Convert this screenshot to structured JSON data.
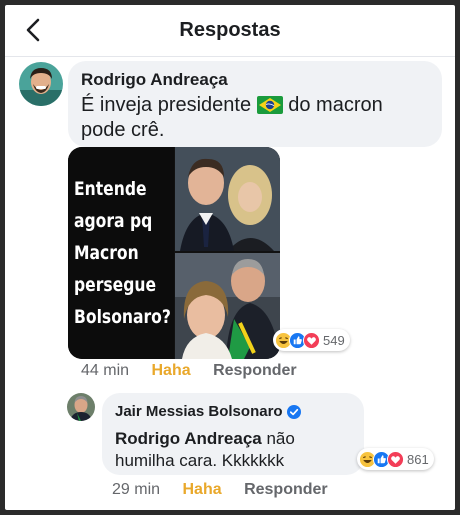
{
  "header": {
    "title": "Respostas",
    "back_icon": "back-arrow-icon"
  },
  "comment": {
    "author": "Rodrigo Andreaça",
    "text_before_flag": "É inveja presidente",
    "flag_icon": "brazil-flag-icon",
    "text_after_flag": "do macron pode crê.",
    "image_caption": "Entende agora pq Macron persegue Bolsonaro?",
    "reactions": {
      "icons": [
        "haha",
        "like",
        "love"
      ],
      "count": "549"
    },
    "time": "44 min",
    "haha_label": "Haha",
    "reply_label": "Responder"
  },
  "reply": {
    "author": "Jair Messias Bolsonaro",
    "verified_icon": "verified-badge-icon",
    "mention": "Rodrigo Andreaça",
    "text": "não humilha cara. Kkkkkkk",
    "reactions": {
      "icons": [
        "haha",
        "like",
        "love"
      ],
      "count": "861"
    },
    "time": "29 min",
    "haha_label": "Haha",
    "reply_label": "Responder"
  },
  "colors": {
    "bubble": "#f0f2f5",
    "haha": "#e9a82b",
    "muted": "#65676b",
    "like": "#1877f2",
    "love": "#f33e58"
  }
}
